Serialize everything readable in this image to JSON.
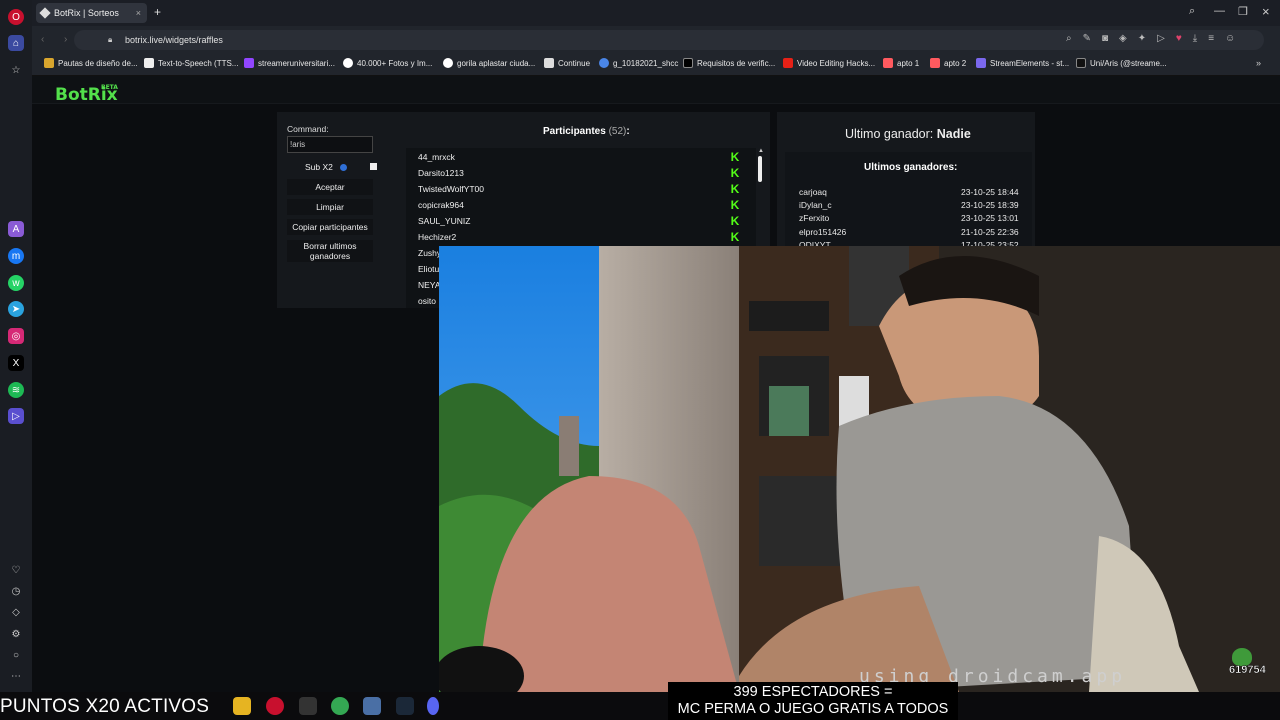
{
  "browser": {
    "tab_title": "BotRix | Sorteos",
    "url": "botrix.live/widgets/raffles",
    "bookmarks": [
      "Pautas de diseño de...",
      "Text-to-Speech (TTS...",
      "streameruniversitari...",
      "40.000+ Fotos y Im...",
      "gorila aplastar ciuda...",
      "Continue",
      "g_10182021_shcc",
      "Requisitos de verific...",
      "Video Editing Hacks...",
      "apto 1",
      "apto 2",
      "StreamElements - st...",
      "Uni/Aris (@streame..."
    ]
  },
  "app": {
    "logo": "BotRix",
    "logo_badge": "BETA"
  },
  "controls": {
    "command_label": "Command:",
    "command_value": "!aris",
    "sub_label": "Sub X2",
    "accept": "Aceptar",
    "clear": "Limpiar",
    "copy": "Copiar participantes",
    "delete_winners": "Borrar ultimos ganadores"
  },
  "participants": {
    "label": "Participantes",
    "count": "(52)",
    "colon": ":",
    "names": [
      "44_mrxck",
      "Darsito1213",
      "TwistedWolfYT00",
      "copicrak964",
      "SAUL_YUNIZ",
      "Hechizer2",
      "Zushy",
      "Eliotu",
      "NEYA",
      "osito"
    ]
  },
  "winner": {
    "label": "Ultimo ganador:",
    "name": "Nadie",
    "recent_title": "Ultimos ganadores:",
    "recent": [
      {
        "name": "carjoaq",
        "date": "23-10-25 18:44"
      },
      {
        "name": "iDylan_c",
        "date": "23-10-25 18:39"
      },
      {
        "name": "zFerxito",
        "date": "23-10-25 13:01"
      },
      {
        "name": "elpro151426",
        "date": "21-10-25 22:36"
      },
      {
        "name": "ODIXYT",
        "date": "17-10-25 23:52"
      }
    ]
  },
  "stream": {
    "watermark": "using droidcam.app",
    "points_banner": "PUNTOS X20 ACTIVOS",
    "caption_line1": "399 ESPECTADORES =",
    "caption_line2": "MC PERMA O JUEGO GRATIS A TODOS",
    "badge_count": "619754"
  }
}
